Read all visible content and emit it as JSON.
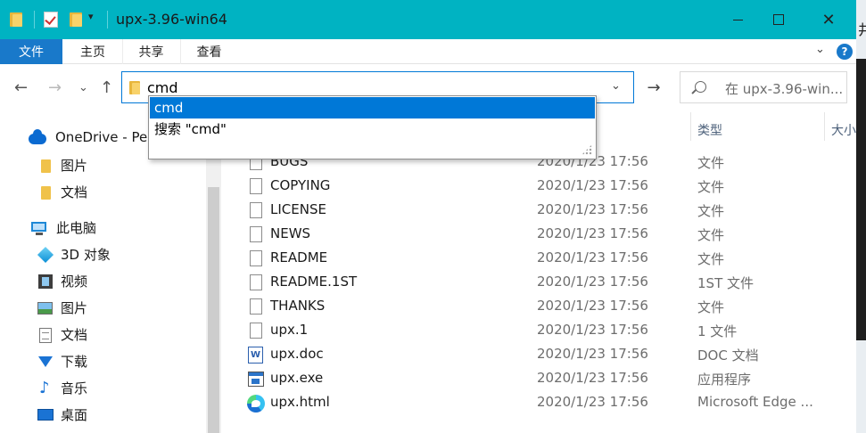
{
  "window": {
    "title": "upx-3.96-win64",
    "close_glyph": "✕"
  },
  "quick_access": {
    "dropdown_glyph": "▾"
  },
  "ribbon": {
    "tabs": [
      "文件",
      "主页",
      "共享",
      "查看"
    ],
    "collapse_glyph": "⌄",
    "help_glyph": "?"
  },
  "address_bar": {
    "back_glyph": "←",
    "forward_glyph": "→",
    "recent_glyph": "⌄",
    "up_glyph": "↑",
    "value": "cmd",
    "dropdown_glyph": "⌄",
    "go_glyph": "→"
  },
  "search": {
    "placeholder": "在 upx-3.96-win..."
  },
  "suggestions": [
    "cmd",
    "搜索 \"cmd\""
  ],
  "nav_pane": {
    "items": [
      {
        "label": "OneDrive - Pers",
        "icon": "onedrive-icon"
      },
      {
        "label": "图片",
        "icon": "folder-icon"
      },
      {
        "label": "文档",
        "icon": "folder-icon"
      },
      {
        "label": "此电脑",
        "icon": "computer-icon"
      },
      {
        "label": "3D 对象",
        "icon": "3d-objects-icon"
      },
      {
        "label": "视频",
        "icon": "video-icon"
      },
      {
        "label": "图片",
        "icon": "pictures-icon"
      },
      {
        "label": "文档",
        "icon": "documents-icon"
      },
      {
        "label": "下载",
        "icon": "download-icon"
      },
      {
        "label": "音乐",
        "icon": "music-icon"
      },
      {
        "label": "桌面",
        "icon": "desktop-icon"
      }
    ]
  },
  "columns": {
    "type": "类型",
    "size": "大小"
  },
  "files": [
    {
      "name": "BUGS",
      "date": "2020/1/23 17:56",
      "type": "文件",
      "icon": "file-icon"
    },
    {
      "name": "COPYING",
      "date": "2020/1/23 17:56",
      "type": "文件",
      "icon": "file-icon"
    },
    {
      "name": "LICENSE",
      "date": "2020/1/23 17:56",
      "type": "文件",
      "icon": "file-icon"
    },
    {
      "name": "NEWS",
      "date": "2020/1/23 17:56",
      "type": "文件",
      "icon": "file-icon"
    },
    {
      "name": "README",
      "date": "2020/1/23 17:56",
      "type": "文件",
      "icon": "file-icon"
    },
    {
      "name": "README.1ST",
      "date": "2020/1/23 17:56",
      "type": "1ST 文件",
      "icon": "file-icon"
    },
    {
      "name": "THANKS",
      "date": "2020/1/23 17:56",
      "type": "文件",
      "icon": "file-icon"
    },
    {
      "name": "upx.1",
      "date": "2020/1/23 17:56",
      "type": "1 文件",
      "icon": "file-icon"
    },
    {
      "name": "upx.doc",
      "date": "2020/1/23 17:56",
      "type": "DOC 文档",
      "icon": "word-doc-icon"
    },
    {
      "name": "upx.exe",
      "date": "2020/1/23 17:56",
      "type": "应用程序",
      "icon": "exe-icon"
    },
    {
      "name": "upx.html",
      "date": "2020/1/23 17:56",
      "type": "Microsoft Edge ...",
      "icon": "edge-icon"
    }
  ],
  "background_window": {
    "glyph": "井"
  },
  "colors": {
    "title_bar": "#00b3c2",
    "file_tab": "#1979ca",
    "selection": "#0078d7"
  }
}
